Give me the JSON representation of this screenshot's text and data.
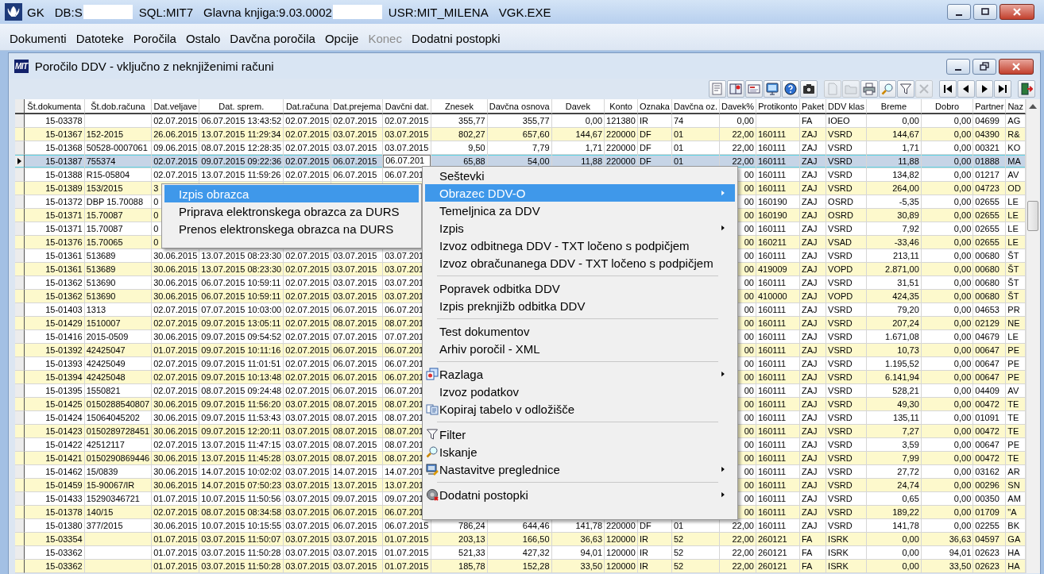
{
  "window": {
    "title_items": [
      {
        "kind": "text",
        "text": "GK"
      },
      {
        "kind": "text",
        "text": "DB:S"
      },
      {
        "kind": "redaction"
      },
      {
        "kind": "text",
        "text": "SQL:MIT7"
      },
      {
        "kind": "text",
        "text": "Glavna knjiga:9.03.0002"
      },
      {
        "kind": "redaction"
      },
      {
        "kind": "text",
        "text": "USR:MIT_MILENA"
      },
      {
        "kind": "text",
        "text": "VGK.EXE"
      }
    ]
  },
  "menubar": [
    {
      "label": "Dokumenti",
      "disabled": false
    },
    {
      "label": "Datoteke",
      "disabled": false
    },
    {
      "label": "Poročila",
      "disabled": false
    },
    {
      "label": "Ostalo",
      "disabled": false
    },
    {
      "label": "Davčna poročila",
      "disabled": false
    },
    {
      "label": "Opcije",
      "disabled": false
    },
    {
      "label": "Konec",
      "disabled": true
    },
    {
      "label": "Dodatni postopki",
      "disabled": false
    }
  ],
  "child_window": {
    "logo": "MIT",
    "title": "Poročilo DDV - vključno z neknjiženimi računi"
  },
  "toolbar": [
    [
      {
        "kind": "report",
        "disabled": false
      },
      {
        "kind": "book",
        "disabled": false
      },
      {
        "kind": "card",
        "disabled": false
      },
      {
        "kind": "monitor",
        "disabled": false
      },
      {
        "kind": "help",
        "disabled": false
      },
      {
        "kind": "camera",
        "disabled": false
      }
    ],
    [
      {
        "kind": "page",
        "disabled": true
      },
      {
        "kind": "folder",
        "disabled": true
      },
      {
        "kind": "printer",
        "disabled": false
      },
      {
        "kind": "search",
        "disabled": false
      },
      {
        "kind": "filter",
        "disabled": false
      },
      {
        "kind": "close",
        "disabled": true
      }
    ],
    [
      {
        "kind": "first",
        "disabled": false
      },
      {
        "kind": "prev",
        "disabled": false
      },
      {
        "kind": "next",
        "disabled": false
      },
      {
        "kind": "last",
        "disabled": false
      }
    ],
    [
      {
        "kind": "exit",
        "disabled": false
      }
    ]
  ],
  "table": {
    "columns": [
      {
        "label": "Št.dokumenta",
        "kind": "number"
      },
      {
        "label": "Št.dob.računa",
        "kind": "text"
      },
      {
        "label": "Dat.veljave",
        "kind": "text"
      },
      {
        "label": "Dat. sprem.",
        "kind": "text"
      },
      {
        "label": "Dat.računa",
        "kind": "text"
      },
      {
        "label": "Dat.prejema",
        "kind": "text"
      },
      {
        "label": "Davčni dat.",
        "kind": "text"
      },
      {
        "label": "Znesek",
        "kind": "number"
      },
      {
        "label": "Davčna osnova",
        "kind": "number"
      },
      {
        "label": "Davek",
        "kind": "number"
      },
      {
        "label": "Konto",
        "kind": "text"
      },
      {
        "label": "Oznaka",
        "kind": "text"
      },
      {
        "label": "Davčna oz.",
        "kind": "text"
      },
      {
        "label": "Davek%",
        "kind": "number"
      },
      {
        "label": "Protikonto",
        "kind": "text"
      },
      {
        "label": "Paket",
        "kind": "text"
      },
      {
        "label": "DDV klas",
        "kind": "text"
      },
      {
        "label": "Breme",
        "kind": "number"
      },
      {
        "label": "Dobro",
        "kind": "number"
      },
      {
        "label": "Partner",
        "kind": "text"
      },
      {
        "label": "Naz",
        "kind": "text"
      }
    ],
    "rows": [
      {
        "selected": false,
        "cells": [
          "15-03378",
          null,
          "02.07.2015",
          "06.07.2015 13:43:52",
          "02.07.2015",
          "02.07.2015",
          "02.07.2015",
          "355,77",
          "355,77",
          "0,00",
          "121380",
          "IR",
          "74",
          "0,00",
          null,
          "FA",
          "IOEO",
          "0,00",
          "0,00",
          "04699",
          "AG"
        ]
      },
      {
        "selected": false,
        "cells": [
          "15-01367",
          "152-2015",
          "26.06.2015",
          "13.07.2015 11:29:34",
          "02.07.2015",
          "03.07.2015",
          "03.07.2015",
          "802,27",
          "657,60",
          "144,67",
          "220000",
          "DF",
          "01",
          "22,00",
          "160111",
          "ZAJ",
          "VSRD",
          "144,67",
          "0,00",
          "04390",
          "R&"
        ]
      },
      {
        "selected": false,
        "cells": [
          "15-01368",
          "50528-0007061",
          "09.06.2015",
          "08.07.2015 12:28:35",
          "02.07.2015",
          "03.07.2015",
          "03.07.2015",
          "9,50",
          "7,79",
          "1,71",
          "220000",
          "DF",
          "01",
          "22,00",
          "160111",
          "ZAJ",
          "VSRD",
          "1,71",
          "0,00",
          "00321",
          "KO"
        ]
      },
      {
        "selected": true,
        "cells": [
          "15-01387",
          "755374",
          "02.07.2015",
          "09.07.2015 09:22:36",
          "02.07.2015",
          "06.07.2015",
          {
            "text": "06.07.201",
            "editing": true
          },
          "65,88",
          "54,00",
          "11,88",
          "220000",
          "DF",
          "01",
          "22,00",
          "160111",
          "ZAJ",
          "VSRD",
          "11,88",
          "0,00",
          "01888",
          "MA"
        ]
      },
      {
        "selected": false,
        "cells": [
          "15-01388",
          "R15-05804",
          "02.07.2015",
          "13.07.2015 11:59:26",
          "02.07.2015",
          "06.07.2015",
          "06.07.201",
          null,
          null,
          null,
          null,
          null,
          null,
          "00",
          "160111",
          "ZAJ",
          "VSRD",
          "134,82",
          "0,00",
          "01217",
          "AV"
        ]
      },
      {
        "selected": false,
        "cells": [
          "15-01389",
          "153/2015",
          "3",
          null,
          null,
          null,
          null,
          null,
          null,
          null,
          null,
          null,
          null,
          "00",
          "160111",
          "ZAJ",
          "VSRD",
          "264,00",
          "0,00",
          "04723",
          "OD"
        ]
      },
      {
        "selected": false,
        "cells": [
          "15-01372",
          "DBP 15.70088",
          "0",
          null,
          null,
          null,
          null,
          null,
          null,
          null,
          null,
          null,
          null,
          "00",
          "160190",
          "ZAJ",
          "OSRD",
          "-5,35",
          "0,00",
          "02655",
          "LE"
        ]
      },
      {
        "selected": false,
        "cells": [
          "15-01371",
          "15.70087",
          "0",
          null,
          null,
          null,
          null,
          null,
          null,
          null,
          null,
          null,
          null,
          "00",
          "160190",
          "ZAJ",
          "OSRD",
          "30,89",
          "0,00",
          "02655",
          "LE"
        ]
      },
      {
        "selected": false,
        "cells": [
          "15-01371",
          "15.70087",
          "0",
          null,
          null,
          null,
          null,
          null,
          null,
          null,
          null,
          null,
          null,
          "00",
          "160111",
          "ZAJ",
          "VSRD",
          "7,92",
          "0,00",
          "02655",
          "LE"
        ]
      },
      {
        "selected": false,
        "cells": [
          "15-01376",
          "15.70065",
          "0",
          null,
          null,
          null,
          null,
          null,
          null,
          null,
          null,
          null,
          null,
          "00",
          "160211",
          "ZAJ",
          "VSAD",
          "-33,46",
          "0,00",
          "02655",
          "LE"
        ]
      },
      {
        "selected": false,
        "cells": [
          "15-01361",
          "513689",
          "30.06.2015",
          "13.07.2015 08:23:30",
          "02.07.2015",
          "03.07.2015",
          "03.07.201",
          null,
          null,
          null,
          null,
          null,
          null,
          "00",
          "160111",
          "ZAJ",
          "VSRD",
          "213,11",
          "0,00",
          "00680",
          "ŠT"
        ]
      },
      {
        "selected": false,
        "cells": [
          "15-01361",
          "513689",
          "30.06.2015",
          "13.07.2015 08:23:30",
          "02.07.2015",
          "03.07.2015",
          "03.07.201",
          null,
          null,
          null,
          null,
          null,
          null,
          "00",
          "419009",
          "ZAJ",
          "VOPD",
          "2.871,00",
          "0,00",
          "00680",
          "ŠT"
        ]
      },
      {
        "selected": false,
        "cells": [
          "15-01362",
          "513690",
          "30.06.2015",
          "06.07.2015 10:59:11",
          "02.07.2015",
          "03.07.2015",
          "03.07.201",
          null,
          null,
          null,
          null,
          null,
          null,
          "00",
          "160111",
          "ZAJ",
          "VSRD",
          "31,51",
          "0,00",
          "00680",
          "ŠT"
        ]
      },
      {
        "selected": false,
        "cells": [
          "15-01362",
          "513690",
          "30.06.2015",
          "06.07.2015 10:59:11",
          "02.07.2015",
          "03.07.2015",
          "03.07.201",
          null,
          null,
          null,
          null,
          null,
          null,
          "00",
          "410000",
          "ZAJ",
          "VOPD",
          "424,35",
          "0,00",
          "00680",
          "ŠT"
        ]
      },
      {
        "selected": false,
        "cells": [
          "15-01403",
          "1313",
          "02.07.2015",
          "07.07.2015 10:03:00",
          "02.07.2015",
          "06.07.2015",
          "06.07.201",
          null,
          null,
          null,
          null,
          null,
          null,
          "00",
          "160111",
          "ZAJ",
          "VSRD",
          "79,20",
          "0,00",
          "04653",
          "PR"
        ]
      },
      {
        "selected": false,
        "cells": [
          "15-01429",
          "1510007",
          "02.07.2015",
          "09.07.2015 13:05:11",
          "02.07.2015",
          "08.07.2015",
          "08.07.201",
          null,
          null,
          null,
          null,
          null,
          null,
          "00",
          "160111",
          "ZAJ",
          "VSRD",
          "207,24",
          "0,00",
          "02129",
          "NE"
        ]
      },
      {
        "selected": false,
        "cells": [
          "15-01416",
          "2015-0509",
          "30.06.2015",
          "09.07.2015 09:54:52",
          "02.07.2015",
          "07.07.2015",
          "07.07.201",
          null,
          null,
          null,
          null,
          null,
          null,
          "00",
          "160111",
          "ZAJ",
          "VSRD",
          "1.671,08",
          "0,00",
          "04679",
          "LE"
        ]
      },
      {
        "selected": false,
        "cells": [
          "15-01392",
          "42425047",
          "01.07.2015",
          "09.07.2015 10:11:16",
          "02.07.2015",
          "06.07.2015",
          "06.07.201",
          null,
          null,
          null,
          null,
          null,
          null,
          "00",
          "160111",
          "ZAJ",
          "VSRD",
          "10,73",
          "0,00",
          "00647",
          "PE"
        ]
      },
      {
        "selected": false,
        "cells": [
          "15-01393",
          "42425049",
          "02.07.2015",
          "09.07.2015 11:01:51",
          "02.07.2015",
          "06.07.2015",
          "06.07.201",
          null,
          null,
          null,
          null,
          null,
          null,
          "00",
          "160111",
          "ZAJ",
          "VSRD",
          "1.195,52",
          "0,00",
          "00647",
          "PE"
        ]
      },
      {
        "selected": false,
        "cells": [
          "15-01394",
          "42425048",
          "02.07.2015",
          "09.07.2015 10:13:48",
          "02.07.2015",
          "06.07.2015",
          "06.07.201",
          null,
          null,
          null,
          null,
          null,
          null,
          "00",
          "160111",
          "ZAJ",
          "VSRD",
          "6.141,94",
          "0,00",
          "00647",
          "PE"
        ]
      },
      {
        "selected": false,
        "cells": [
          "15-01395",
          "1550821",
          "02.07.2015",
          "08.07.2015 09:24:48",
          "02.07.2015",
          "06.07.2015",
          "06.07.201",
          null,
          null,
          null,
          null,
          null,
          null,
          "00",
          "160111",
          "ZAJ",
          "VSRD",
          "528,21",
          "0,00",
          "04409",
          "AV"
        ]
      },
      {
        "selected": false,
        "cells": [
          "15-01425",
          "0150288540807",
          "30.06.2015",
          "09.07.2015 11:56:20",
          "03.07.2015",
          "08.07.2015",
          "08.07.201",
          null,
          null,
          null,
          null,
          null,
          null,
          "00",
          "160111",
          "ZAJ",
          "VSRD",
          "49,30",
          "0,00",
          "00472",
          "TE"
        ]
      },
      {
        "selected": false,
        "cells": [
          "15-01424",
          "15064045202",
          "30.06.2015",
          "09.07.2015 11:53:43",
          "03.07.2015",
          "08.07.2015",
          "08.07.201",
          null,
          null,
          null,
          null,
          null,
          null,
          "00",
          "160111",
          "ZAJ",
          "VSRD",
          "135,11",
          "0,00",
          "01091",
          "TE"
        ]
      },
      {
        "selected": false,
        "cells": [
          "15-01423",
          "0150289728451",
          "30.06.2015",
          "09.07.2015 12:20:11",
          "03.07.2015",
          "08.07.2015",
          "08.07.201",
          null,
          null,
          null,
          null,
          null,
          null,
          "00",
          "160111",
          "ZAJ",
          "VSRD",
          "7,27",
          "0,00",
          "00472",
          "TE"
        ]
      },
      {
        "selected": false,
        "cells": [
          "15-01422",
          "42512117",
          "02.07.2015",
          "13.07.2015 11:47:15",
          "03.07.2015",
          "08.07.2015",
          "08.07.201",
          null,
          null,
          null,
          null,
          null,
          null,
          "00",
          "160111",
          "ZAJ",
          "VSRD",
          "3,59",
          "0,00",
          "00647",
          "PE"
        ]
      },
      {
        "selected": false,
        "cells": [
          "15-01421",
          "0150290869446",
          "30.06.2015",
          "13.07.2015 11:45:28",
          "03.07.2015",
          "08.07.2015",
          "08.07.201",
          null,
          null,
          null,
          null,
          null,
          null,
          "00",
          "160111",
          "ZAJ",
          "VSRD",
          "7,99",
          "0,00",
          "00472",
          "TE"
        ]
      },
      {
        "selected": false,
        "cells": [
          "15-01462",
          "15/0839",
          "30.06.2015",
          "14.07.2015 10:02:02",
          "03.07.2015",
          "14.07.2015",
          "14.07.201",
          null,
          null,
          null,
          null,
          null,
          null,
          "00",
          "160111",
          "ZAJ",
          "VSRD",
          "27,72",
          "0,00",
          "03162",
          "AR"
        ]
      },
      {
        "selected": false,
        "cells": [
          "15-01459",
          "15-90067/IR",
          "30.06.2015",
          "14.07.2015 07:50:23",
          "03.07.2015",
          "13.07.2015",
          "13.07.201",
          null,
          null,
          null,
          null,
          null,
          null,
          "00",
          "160111",
          "ZAJ",
          "VSRD",
          "24,74",
          "0,00",
          "00296",
          "SN"
        ]
      },
      {
        "selected": false,
        "cells": [
          "15-01433",
          "15290346721",
          "01.07.2015",
          "10.07.2015 11:50:56",
          "03.07.2015",
          "09.07.2015",
          "09.07.201",
          null,
          null,
          null,
          null,
          null,
          null,
          "00",
          "160111",
          "ZAJ",
          "VSRD",
          "0,65",
          "0,00",
          "00350",
          "AM"
        ]
      },
      {
        "selected": false,
        "cells": [
          "15-01378",
          "140/15",
          "02.07.2015",
          "08.07.2015 08:34:58",
          "03.07.2015",
          "06.07.2015",
          "06.07.201",
          null,
          null,
          null,
          null,
          null,
          null,
          "00",
          "160111",
          "ZAJ",
          "VSRD",
          "189,22",
          "0,00",
          "01709",
          "\"A"
        ]
      },
      {
        "selected": false,
        "cells": [
          "15-01380",
          "377/2015",
          "30.06.2015",
          "10.07.2015 10:15:55",
          "03.07.2015",
          "06.07.2015",
          "06.07.2015",
          "786,24",
          "644,46",
          "141,78",
          "220000",
          "DF",
          "01",
          "22,00",
          "160111",
          "ZAJ",
          "VSRD",
          "141,78",
          "0,00",
          "02255",
          "BK"
        ]
      },
      {
        "selected": false,
        "cells": [
          "15-03354",
          null,
          "01.07.2015",
          "03.07.2015 11:50:07",
          "03.07.2015",
          "03.07.2015",
          "01.07.2015",
          "203,13",
          "166,50",
          "36,63",
          "120000",
          "IR",
          "52",
          "22,00",
          "260121",
          "FA",
          "ISRK",
          "0,00",
          "36,63",
          "04597",
          "GA"
        ]
      },
      {
        "selected": false,
        "cells": [
          "15-03362",
          null,
          "01.07.2015",
          "03.07.2015 11:50:28",
          "03.07.2015",
          "03.07.2015",
          "01.07.2015",
          "521,33",
          "427,32",
          "94,01",
          "120000",
          "IR",
          "52",
          "22,00",
          "260121",
          "FA",
          "ISRK",
          "0,00",
          "94,01",
          "02623",
          "HA"
        ]
      },
      {
        "selected": false,
        "cells": [
          "15-03362",
          null,
          "01.07.2015",
          "03.07.2015 11:50:28",
          "03.07.2015",
          "03.07.2015",
          "01.07.2015",
          "185,78",
          "152,28",
          "33,50",
          "120000",
          "IR",
          "52",
          "22,00",
          "260121",
          "FA",
          "ISRK",
          "0,00",
          "33,50",
          "02623",
          "HA"
        ]
      }
    ]
  },
  "context_menu": {
    "items": [
      {
        "kind": "plain",
        "label": "Seštevki",
        "selected": false,
        "submenu": false
      },
      {
        "kind": "plain",
        "label": "Obrazec DDV-O",
        "selected": true,
        "submenu": true
      },
      {
        "kind": "plain",
        "label": "Temeljnica za DDV",
        "selected": false,
        "submenu": false
      },
      {
        "kind": "plain",
        "label": "Izpis",
        "selected": false,
        "submenu": true
      },
      {
        "kind": "plain",
        "label": "Izvoz odbitnega DDV - TXT ločeno s podpičjem",
        "selected": false,
        "submenu": false
      },
      {
        "kind": "plain",
        "label": "Izvoz obračunanega DDV - TXT ločeno s podpičjem",
        "selected": false,
        "submenu": false
      },
      {
        "kind": "separator"
      },
      {
        "kind": "plain",
        "label": "Popravek odbitka DDV",
        "selected": false,
        "submenu": false
      },
      {
        "kind": "plain",
        "label": "Izpis preknjižb odbitka DDV",
        "selected": false,
        "submenu": false
      },
      {
        "kind": "separator"
      },
      {
        "kind": "plain",
        "label": "Test dokumentov",
        "selected": false,
        "submenu": false
      },
      {
        "kind": "plain",
        "label": "Arhiv poročil - XML",
        "selected": false,
        "submenu": false
      },
      {
        "kind": "separator"
      },
      {
        "kind": "help-window",
        "label": "Razlaga",
        "selected": false,
        "submenu": true
      },
      {
        "kind": "plain",
        "label": "Izvoz podatkov",
        "selected": false,
        "submenu": false
      },
      {
        "kind": "copy",
        "label": "Kopiraj tabelo v odložišče",
        "selected": false,
        "submenu": false
      },
      {
        "kind": "separator"
      },
      {
        "kind": "filter",
        "label": "Filter",
        "selected": false,
        "submenu": false
      },
      {
        "kind": "search",
        "label": "Iskanje",
        "selected": false,
        "submenu": false
      },
      {
        "kind": "settings",
        "label": "Nastavitve preglednice",
        "selected": false,
        "submenu": true
      },
      {
        "kind": "separator"
      },
      {
        "kind": "gear",
        "label": "Dodatni postopki",
        "selected": false,
        "submenu": true
      }
    ]
  },
  "submenu": {
    "items": [
      {
        "label": "Izpis obrazca",
        "selected": true,
        "submenu": false
      },
      {
        "label": "Priprava elektronskega obrazca za DURS",
        "selected": false,
        "submenu": false
      },
      {
        "label": "Prenos elektronskega obrazca na DURS",
        "selected": false,
        "submenu": false
      }
    ]
  }
}
